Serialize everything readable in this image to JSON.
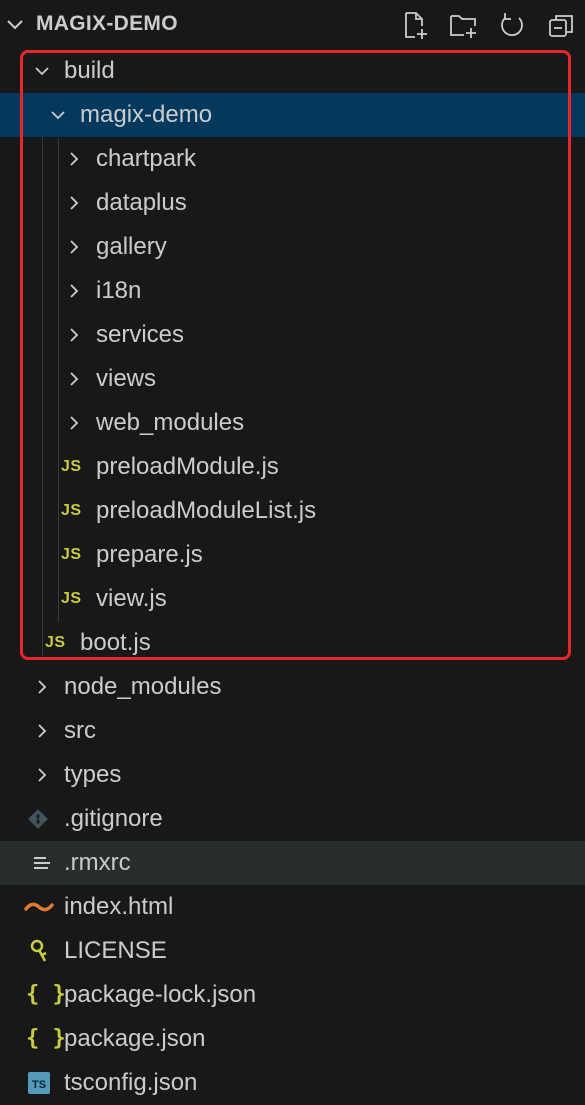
{
  "explorer": {
    "title": "MAGIX-DEMO",
    "actions": [
      "new-file-icon",
      "new-folder-icon",
      "refresh-icon",
      "collapse-all-icon"
    ]
  },
  "tree": {
    "build": "build",
    "magix_demo": "magix-demo",
    "chartpark": "chartpark",
    "dataplus": "dataplus",
    "gallery": "gallery",
    "i18n": "i18n",
    "services": "services",
    "views": "views",
    "web_modules": "web_modules",
    "preloadModule": "preloadModule.js",
    "preloadModuleList": "preloadModuleList.js",
    "prepare": "prepare.js",
    "view": "view.js",
    "boot": "boot.js",
    "node_modules": "node_modules",
    "src": "src",
    "types": "types",
    "gitignore": ".gitignore",
    "rmxrc": ".rmxrc",
    "index_html": "index.html",
    "license": "LICENSE",
    "package_lock": "package-lock.json",
    "package_json": "package.json",
    "tsconfig": "tsconfig.json"
  },
  "badges": {
    "js": "JS",
    "ts": "TS",
    "json": "{ }"
  },
  "colors": {
    "background": "#181818",
    "selected": "#04395e",
    "highlight_border": "#e8262c",
    "js": "#cbcb41",
    "ts": "#519aba",
    "html": "#e37933",
    "license": "#cbcb41"
  }
}
